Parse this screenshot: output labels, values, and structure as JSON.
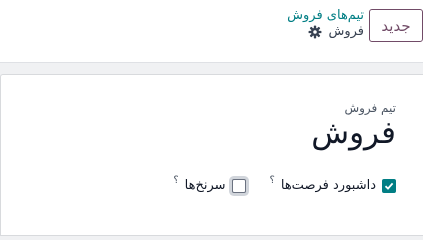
{
  "control_panel": {
    "new_label": "جدید",
    "breadcrumb": "تیم‌های فروش",
    "current": "فروش",
    "gear_icon": "gear-icon"
  },
  "form": {
    "team_label": "تیم فروش",
    "team_name": "فروش",
    "options": [
      {
        "label": "داشبورد فرصت‌ها",
        "checked": true,
        "help": "؟"
      },
      {
        "label": "سرنخ‌ها",
        "checked": false,
        "help": "؟"
      }
    ]
  },
  "colors": {
    "brand": "#714b67",
    "accent": "#017e84"
  }
}
